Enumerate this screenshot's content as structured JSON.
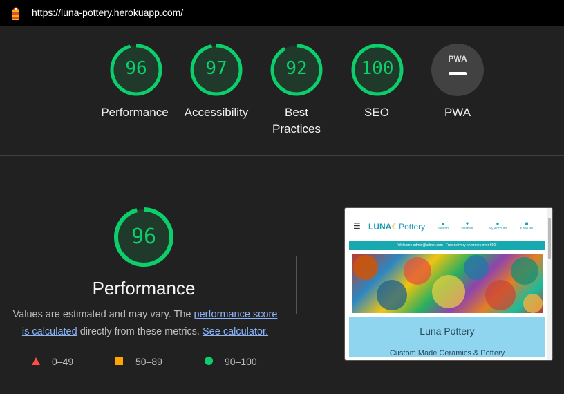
{
  "topbar": {
    "url": "https://luna-pottery.herokuapp.com/"
  },
  "scores": [
    {
      "label_line1": "Performance",
      "label_line2": "",
      "value": "96"
    },
    {
      "label_line1": "Accessibility",
      "label_line2": "",
      "value": "97"
    },
    {
      "label_line1": "Best",
      "label_line2": "Practices",
      "value": "92"
    },
    {
      "label_line1": "SEO",
      "label_line2": "",
      "value": "100"
    },
    {
      "label_line1": "PWA",
      "label_line2": "",
      "value": "PWA"
    }
  ],
  "colors": {
    "pass": "#0cce6b",
    "average": "#ffa400",
    "fail": "#ff4e42",
    "link": "#8ab4f8"
  },
  "performance": {
    "score": "96",
    "title": "Performance",
    "desc_1": "Values are estimated and may vary. The",
    "link_1a": "performance score",
    "link_1b": "is calculated",
    "desc_2": "directly from these metrics.",
    "link_2": "See calculator."
  },
  "legend": [
    {
      "icon": "triangle-icon",
      "range": "0–49"
    },
    {
      "icon": "square-icon",
      "range": "50–89"
    },
    {
      "icon": "circle-icon",
      "range": "90–100"
    }
  ],
  "screenshot": {
    "logo_a": "LUNA",
    "logo_b": "Pottery",
    "nav": [
      "Search",
      "Wishlist",
      "My Account",
      "€808.90"
    ],
    "banner": "Welcome admin@admin.com | Free delivery on orders over €60!",
    "hero_title": "Luna Pottery",
    "hero_sub": "Custom Made Ceramics & Pottery"
  }
}
